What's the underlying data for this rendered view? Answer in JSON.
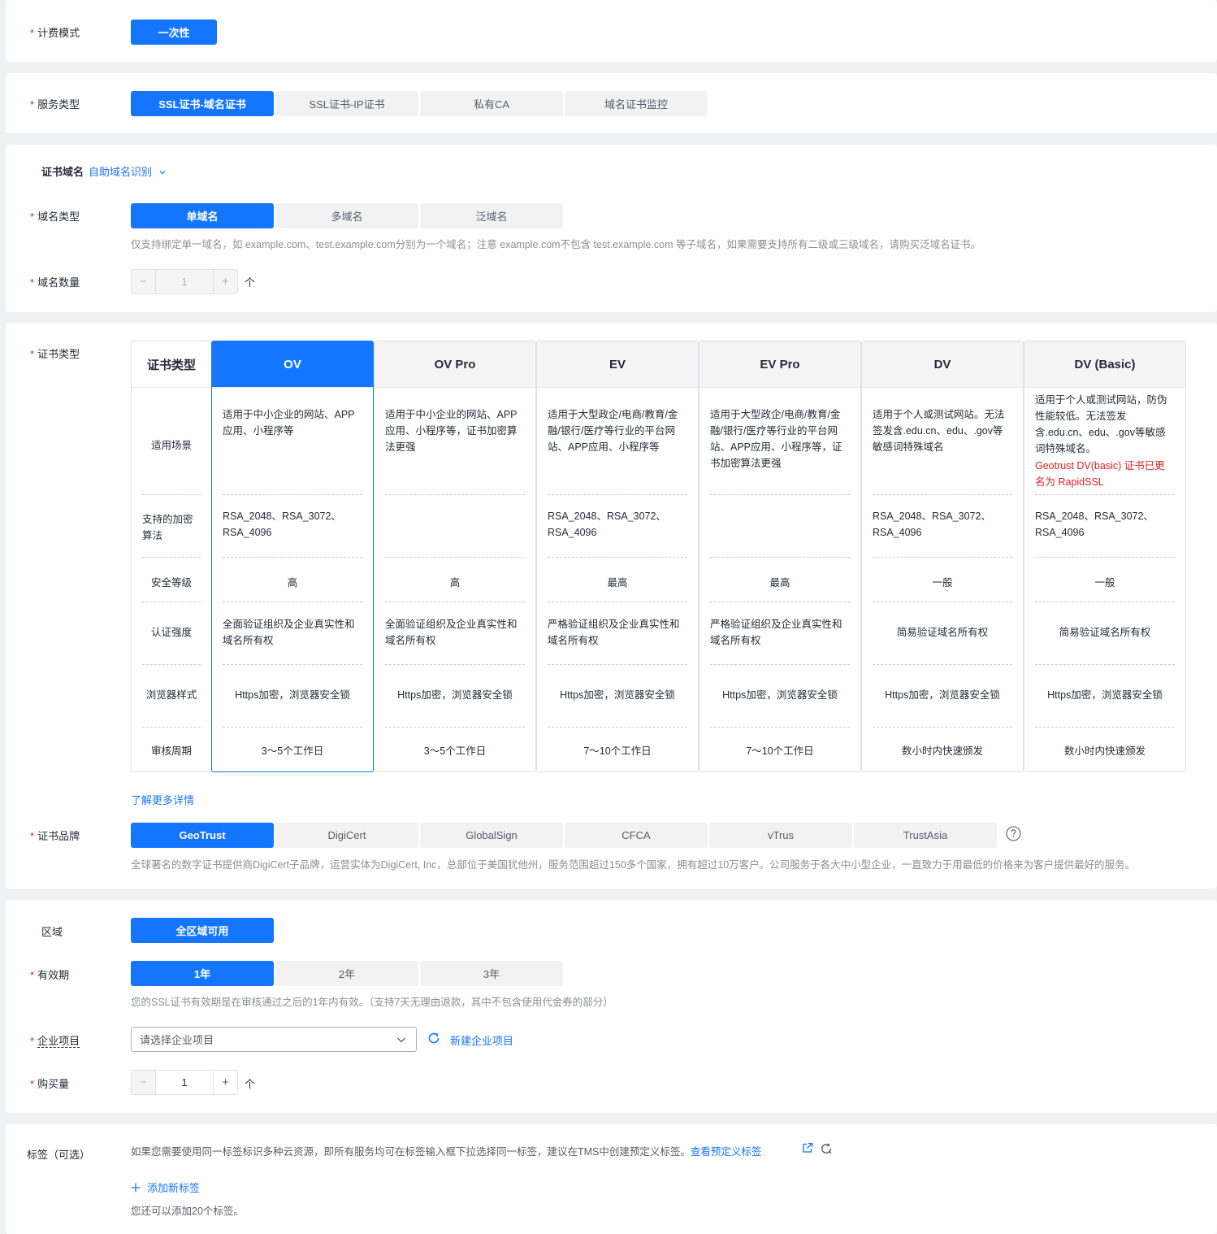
{
  "billing": {
    "label": "计费模式",
    "options": [
      "一次性"
    ]
  },
  "service": {
    "label": "服务类型",
    "options": [
      "SSL证书-域名证书",
      "SSL证书-IP证书",
      "私有CA",
      "域名证书监控"
    ]
  },
  "domain_section": {
    "title": "证书域名",
    "helper_link": "自助域名识别",
    "type_label": "域名类型",
    "type_options": [
      "单域名",
      "多域名",
      "泛域名"
    ],
    "type_tip": "仅支持绑定单一域名，如 example.com、test.example.com分别为一个域名；注意 example.com不包含 test.example.com 等子域名，如果需要支持所有二级或三级域名，请购买泛域名证书。",
    "count_label": "域名数量",
    "count_value": "1",
    "count_unit": "个"
  },
  "cert_type": {
    "label": "证书类型",
    "header": "证书类型",
    "row_labels": [
      "适用场景",
      "支持的加密算法",
      "安全等级",
      "认证强度",
      "浏览器样式",
      "审核周期"
    ],
    "columns": [
      {
        "name": "OV",
        "scene": "适用于中小企业的网站、APP应用、小程序等",
        "algo": "RSA_2048、RSA_3072、RSA_4096",
        "level": "高",
        "auth": "全面验证组织及企业真实性和域名所有权",
        "browser": "Https加密，浏览器安全锁",
        "period": "3～5个工作日"
      },
      {
        "name": "OV Pro",
        "scene": "适用于中小企业的网站、APP应用、小程序等，证书加密算法更强",
        "algo": "",
        "level": "高",
        "auth": "全面验证组织及企业真实性和域名所有权",
        "browser": "Https加密，浏览器安全锁",
        "period": "3～5个工作日"
      },
      {
        "name": "EV",
        "scene": "适用于大型政企/电商/教育/金融/银行/医疗等行业的平台网站、APP应用、小程序等",
        "algo": "RSA_2048、RSA_3072、RSA_4096",
        "level": "最高",
        "auth": "严格验证组织及企业真实性和域名所有权",
        "browser": "Https加密，浏览器安全锁",
        "period": "7～10个工作日"
      },
      {
        "name": "EV Pro",
        "scene": "适用于大型政企/电商/教育/金融/银行/医疗等行业的平台网站、APP应用、小程序等，证书加密算法更强",
        "algo": "",
        "level": "最高",
        "auth": "严格验证组织及企业真实性和域名所有权",
        "browser": "Https加密，浏览器安全锁",
        "period": "7～10个工作日"
      },
      {
        "name": "DV",
        "scene": "适用于个人或测试网站。无法签发含.edu.cn、edu、.gov等敏感词特殊域名",
        "algo": "RSA_2048、RSA_3072、RSA_4096",
        "level": "一般",
        "auth": "简易验证域名所有权",
        "browser": "Https加密，浏览器安全锁",
        "period": "数小时内快速颁发"
      },
      {
        "name": "DV (Basic)",
        "scene": "适用于个人或测试网站，防伪性能较低。无法签发含.edu.cn、edu、.gov等敏感词特殊域名。",
        "scene_note": "Geotrust DV(basic) 证书已更名为 RapidSSL",
        "algo": "RSA_2048、RSA_3072、RSA_4096",
        "level": "一般",
        "auth": "简易验证域名所有权",
        "browser": "Https加密，浏览器安全锁",
        "period": "数小时内快速颁发"
      }
    ],
    "more_link": "了解更多详情"
  },
  "brand": {
    "label": "证书品牌",
    "options": [
      "GeoTrust",
      "DigiCert",
      "GlobalSign",
      "CFCA",
      "vTrus",
      "TrustAsia"
    ],
    "tip": "全球著名的数字证书提供商DigiCert子品牌，运营实体为DigiCert, Inc，总部位于美国犹他州，服务范围超过150多个国家，拥有超过10万客户。公司服务于各大中小型企业，一直致力于用最低的价格来为客户提供最好的服务。"
  },
  "region": {
    "label": "区域",
    "options": [
      "全区域可用"
    ]
  },
  "validity": {
    "label": "有效期",
    "options": [
      "1年",
      "2年",
      "3年"
    ],
    "tip": "您的SSL证书有效期是在审核通过之后的1年内有效。（支持7天无理由退款，其中不包含使用代金券的部分）"
  },
  "project": {
    "label": "企业项目",
    "placeholder": "请选择企业项目",
    "new_link": "新建企业项目"
  },
  "quantity": {
    "label": "购买量",
    "value": "1",
    "unit": "个"
  },
  "tags": {
    "label": "标签（可选）",
    "desc": "如果您需要使用同一标签标识多种云资源，即所有服务均可在标签输入框下拉选择同一标签，建议在TMS中创建预定义标签。",
    "view_link": "查看预定义标签",
    "add_link": "添加新标签",
    "remaining": "您还可以添加20个标签。"
  },
  "colors": {
    "accent": "#1476ff",
    "required": "#e02020",
    "tip": "#8a8e99"
  }
}
